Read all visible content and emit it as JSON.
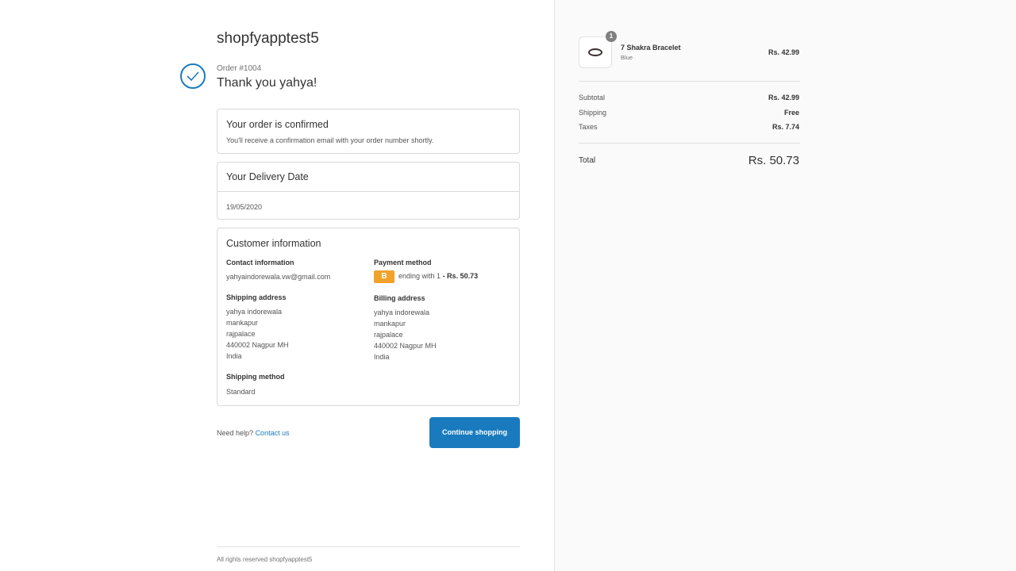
{
  "store": {
    "name": "shopfyapptest5"
  },
  "order": {
    "number": "Order #1004",
    "thank_you": "Thank you yahya!"
  },
  "confirmation": {
    "title": "Your order is confirmed",
    "text": "You'll receive a confirmation email with your order number shortly."
  },
  "delivery": {
    "title": "Your Delivery Date",
    "date": "19/05/2020"
  },
  "customer": {
    "title": "Customer information",
    "contact_label": "Contact information",
    "contact_email": "yahyaindorewala.vw@gmail.com",
    "payment_label": "Payment method",
    "payment_badge": "B",
    "payment_ending": "ending with 1",
    "payment_amount": "- Rs. 50.73",
    "shipping_address_label": "Shipping address",
    "shipping_address": [
      "yahya indorewala",
      "mankapur",
      "rajpalace",
      "440002 Nagpur MH",
      "India"
    ],
    "billing_address_label": "Billing address",
    "billing_address": [
      "yahya indorewala",
      "mankapur",
      "rajpalace",
      "440002 Nagpur MH",
      "India"
    ],
    "shipping_method_label": "Shipping method",
    "shipping_method": "Standard"
  },
  "help": {
    "prefix": "Need help?",
    "link": "Contact us"
  },
  "continue_button": "Continue shopping",
  "footer": "All rights reserved shopfyapptest5",
  "cart": {
    "items": [
      {
        "quantity": "1",
        "name": "7 Shakra Bracelet",
        "variant": "Blue",
        "price": "Rs. 42.99"
      }
    ],
    "subtotal_label": "Subtotal",
    "subtotal": "Rs. 42.99",
    "shipping_label": "Shipping",
    "shipping": "Free",
    "taxes_label": "Taxes",
    "taxes": "Rs. 7.74",
    "total_label": "Total",
    "total": "Rs. 50.73"
  },
  "colors": {
    "accent": "#197bbd",
    "payment_badge": "#f0a22b",
    "sidebar_bg": "#fafafa"
  }
}
